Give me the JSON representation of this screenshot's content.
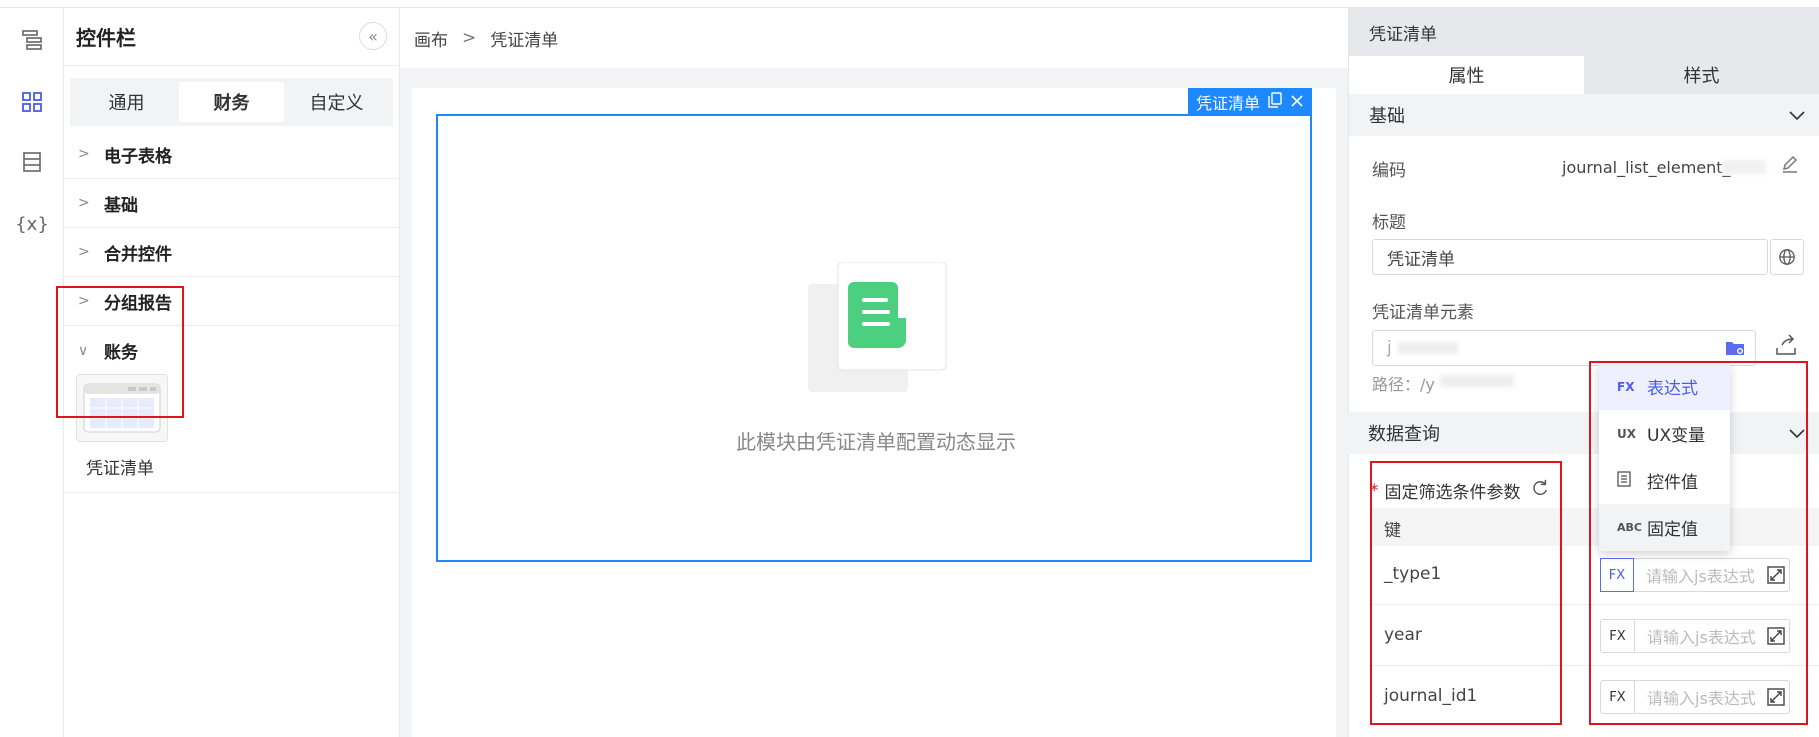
{
  "rail": {
    "icons": [
      "layers-icon",
      "grid-icon",
      "list-icon",
      "variable-icon"
    ],
    "variable_label": "{x}"
  },
  "widget_panel": {
    "title": "控件栏",
    "collapse_symbol": "«",
    "tabs": [
      {
        "label": "通用",
        "active": false
      },
      {
        "label": "财务",
        "active": true
      },
      {
        "label": "自定义",
        "active": false
      }
    ],
    "groups": [
      {
        "label": "电子表格"
      },
      {
        "label": "基础"
      },
      {
        "label": "合并控件"
      },
      {
        "label": "分组报告"
      }
    ],
    "open_group": {
      "label": "账务",
      "widget_label": "凭证清单"
    }
  },
  "canvas": {
    "breadcrumb": {
      "root": "画布",
      "sep": ">",
      "current": "凭证清单"
    },
    "selected_tag": "凭证清单",
    "placeholder_text": "此模块由凭证清单配置动态显示"
  },
  "properties": {
    "title": "凭证清单",
    "tabs": [
      {
        "label": "属性",
        "active": true
      },
      {
        "label": "样式",
        "active": false
      }
    ],
    "basic": {
      "section": "基础",
      "code_label": "编码",
      "code_value": "journal_list_element_",
      "title_label": "标题",
      "title_value": "凭证清单",
      "element_label": "凭证清单元素",
      "element_value": "j",
      "path_label": "路径：/y"
    },
    "query": {
      "section": "数据查询",
      "param_label": "固定筛选条件参数",
      "required_mark": "*",
      "key_header": "键",
      "rows": [
        {
          "key": "_type1",
          "mode": "FX",
          "placeholder": "请输入js表达式"
        },
        {
          "key": "year",
          "mode": "FX",
          "placeholder": "请输入js表达式"
        },
        {
          "key": "journal_id1",
          "mode": "FX",
          "placeholder": "请输入js表达式"
        }
      ]
    },
    "dropdown": [
      {
        "code": "FX",
        "label": "表达式",
        "state": "active"
      },
      {
        "code": "UX",
        "label": "UX变量",
        "state": ""
      },
      {
        "code": "≡",
        "label": "控件值",
        "state": ""
      },
      {
        "code": "ABC",
        "label": "固定值",
        "state": "hover"
      }
    ]
  },
  "colors": {
    "accent": "#1e88ff",
    "highlight": "#e0141e",
    "dropdown_active": "#4a5de8",
    "doc_icon": "#4cd080"
  }
}
